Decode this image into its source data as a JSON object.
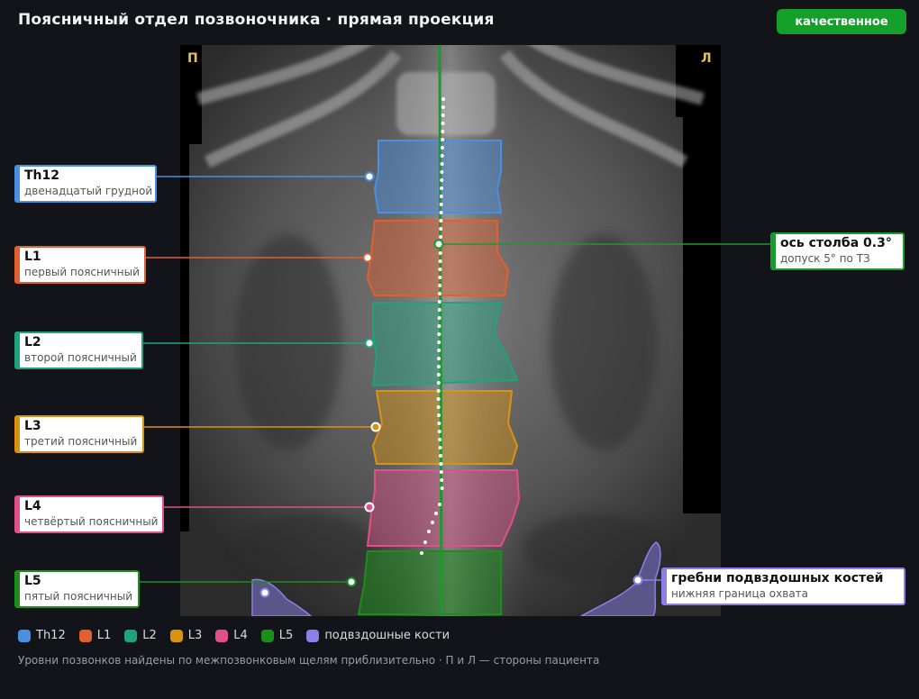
{
  "header": {
    "title": "Поясничный отдел позвоночника · прямая проекция",
    "badge": "качественное"
  },
  "image": {
    "side_right": "П",
    "side_left": "Л"
  },
  "vertebrae": [
    {
      "id": "Th12",
      "name": "Th12",
      "desc": "двенадцатый грудной",
      "color": "#4a90e2"
    },
    {
      "id": "L1",
      "name": "L1",
      "desc": "первый поясничный",
      "color": "#e0602f"
    },
    {
      "id": "L2",
      "name": "L2",
      "desc": "второй поясничный",
      "color": "#1fa37a"
    },
    {
      "id": "L3",
      "name": "L3",
      "desc": "третий поясничный",
      "color": "#d9930f"
    },
    {
      "id": "L4",
      "name": "L4",
      "desc": "четвёртый поясничный",
      "color": "#e0508a"
    },
    {
      "id": "L5",
      "name": "L5",
      "desc": "пятый поясничный",
      "color": "#1a8f1a"
    }
  ],
  "axis": {
    "title": "ось столба 0.3°",
    "desc": "допуск 5° по ТЗ",
    "color": "#1a9a2a"
  },
  "iliac": {
    "title": "гребни подвздошных костей",
    "desc": "нижняя граница охвата",
    "color": "#8a80e6"
  },
  "legend": [
    {
      "label": "Th12",
      "color": "#4a90e2"
    },
    {
      "label": "L1",
      "color": "#e0602f"
    },
    {
      "label": "L2",
      "color": "#1fa37a"
    },
    {
      "label": "L3",
      "color": "#d9930f"
    },
    {
      "label": "L4",
      "color": "#e0508a"
    },
    {
      "label": "L5",
      "color": "#1a8f1a"
    },
    {
      "label": "подвздошные кости",
      "color": "#8a80e6"
    }
  ],
  "footnote": "Уровни позвонков найдены по межпозвонковым щелям приблизительно · П и Л — стороны пациента"
}
